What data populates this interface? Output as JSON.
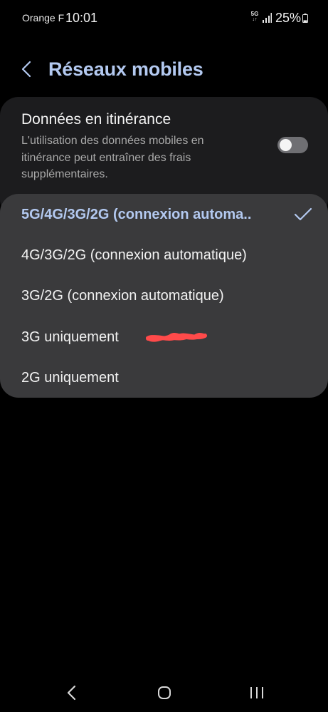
{
  "status_bar": {
    "carrier": "Orange F",
    "time": "10:01",
    "network_type": "5G",
    "battery_percent": "25%",
    "battery_level": 0.25
  },
  "header": {
    "title": "Réseaux mobiles",
    "back_icon": "chevron-left-icon"
  },
  "roaming": {
    "title": "Données en itinérance",
    "description": "L'utilisation des données mobiles en itinérance peut entraîner des frais supplémentaires.",
    "enabled": false
  },
  "network_mode": {
    "options": [
      {
        "label": "5G/4G/3G/2G (connexion automa..",
        "selected": true
      },
      {
        "label": "4G/3G/2G (connexion automatique)",
        "selected": false
      },
      {
        "label": "3G/2G (connexion automatique)",
        "selected": false
      },
      {
        "label": "3G uniquement",
        "selected": false
      },
      {
        "label": "2G uniquement",
        "selected": false
      }
    ],
    "check_icon": "checkmark-icon",
    "redaction_color": "#ff4a4a"
  },
  "colors": {
    "accent": "#b3c9f0",
    "background": "#000000",
    "card": "#1c1c1e",
    "dropdown": "#3a3a3c"
  },
  "nav_bar": {
    "back_icon": "nav-back-icon",
    "home_icon": "nav-home-icon",
    "recents_icon": "nav-recents-icon"
  }
}
